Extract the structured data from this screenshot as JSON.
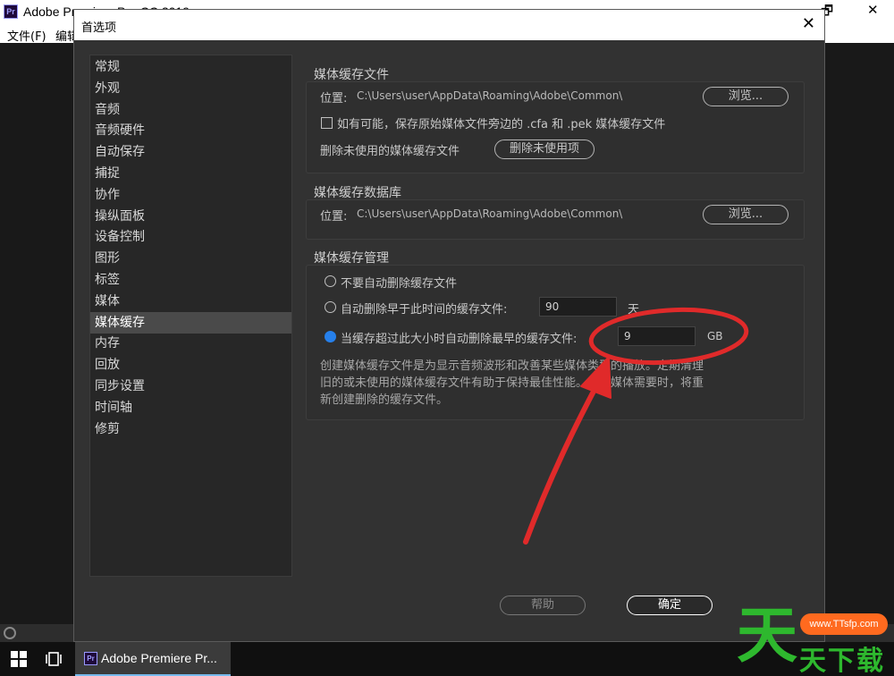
{
  "app": {
    "title": "Adobe Premiere Pro CC 2019",
    "logo": "Pr",
    "menus": [
      "文件(F)",
      "编辑"
    ],
    "controls": {
      "restore": "🗗",
      "close": "✕"
    }
  },
  "dialog": {
    "title": "首选项",
    "close": "✕",
    "sidebar": {
      "items": [
        "常规",
        "外观",
        "音频",
        "音频硬件",
        "自动保存",
        "捕捉",
        "协作",
        "操纵面板",
        "设备控制",
        "图形",
        "标签",
        "媒体",
        "媒体缓存",
        "内存",
        "回放",
        "同步设置",
        "时间轴",
        "修剪"
      ],
      "active_index": 12
    },
    "cache_files": {
      "title": "媒体缓存文件",
      "location_label": "位置:",
      "location_path": "C:\\Users\\user\\AppData\\Roaming\\Adobe\\Common\\",
      "browse": "浏览...",
      "checkbox_label": "如有可能，保存原始媒体文件旁边的 .cfa 和 .pek 媒体缓存文件",
      "checkbox_checked": false,
      "delete_label": "删除未使用的媒体缓存文件",
      "delete_button": "删除未使用项"
    },
    "cache_db": {
      "title": "媒体缓存数据库",
      "location_label": "位置:",
      "location_path": "C:\\Users\\user\\AppData\\Roaming\\Adobe\\Common\\",
      "browse": "浏览..."
    },
    "cache_mgmt": {
      "title": "媒体缓存管理",
      "option_never": "不要自动删除缓存文件",
      "option_older": "自动删除早于此时间的缓存文件:",
      "older_value": "90",
      "older_unit": "天",
      "option_size": "当缓存超过此大小时自动删除最早的缓存文件:",
      "size_value": "9",
      "size_unit": "GB",
      "selected": "size",
      "description": "创建媒体缓存文件是为显示音频波形和改善某些媒体类型的播放。定期清理旧的或未使用的媒体缓存文件有助于保持最佳性能。在源媒体需要时，将重新创建删除的缓存文件。"
    },
    "footer": {
      "help": "帮助",
      "ok": "确定"
    }
  },
  "taskbar": {
    "app_label": "Adobe Premiere Pr...",
    "app_logo": "Pr"
  },
  "annotation": {
    "color": "#e02a2a"
  },
  "watermark": {
    "big": "天",
    "url": "www.TTsfp.com",
    "small": "天下载"
  }
}
